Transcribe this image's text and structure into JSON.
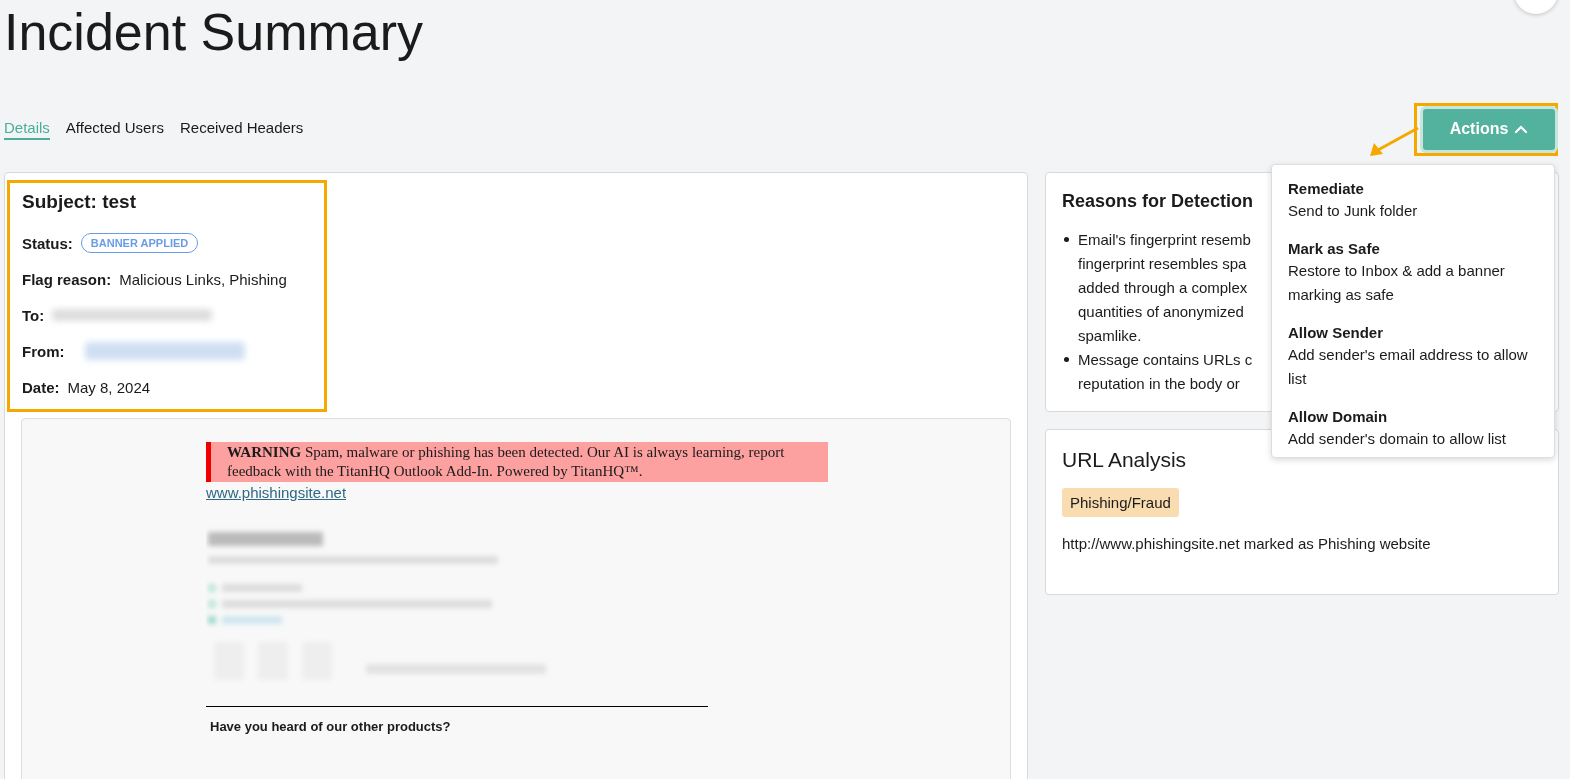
{
  "page": {
    "title": "Incident Summary"
  },
  "tabs": [
    {
      "label": "Details",
      "selected": true
    },
    {
      "label": "Affected Users",
      "selected": false
    },
    {
      "label": "Received Headers",
      "selected": false
    }
  ],
  "actions_button": {
    "label": "Actions",
    "expanded": true
  },
  "actions_menu": [
    {
      "title": "Remediate",
      "description": "Send to Junk folder"
    },
    {
      "title": "Mark as Safe",
      "description": "Restore to Inbox & add a banner marking as safe"
    },
    {
      "title": "Allow Sender",
      "description": "Add sender's email address to allow list"
    },
    {
      "title": "Allow Domain",
      "description": "Add sender's domain to allow list"
    }
  ],
  "summary": {
    "subject": "Subject: test",
    "fields": [
      {
        "label": "Status:",
        "kind": "badge",
        "value": "BANNER APPLIED"
      },
      {
        "label": "Flag reason:",
        "kind": "text",
        "value": "Malicious Links, Phishing"
      },
      {
        "label": "To:",
        "kind": "redacted"
      },
      {
        "label": "From:",
        "kind": "redacted_highlight"
      },
      {
        "label": "Date:",
        "kind": "text",
        "value": "May 8, 2024"
      }
    ]
  },
  "email_preview": {
    "warning": "**WARNING** Spam, malware or phishing has been detected. Our AI is always learning, report feedback with the TitanHQ Outlook Add-In. Powered by TitanHQ™.",
    "link": "www.phishingsite.net",
    "footer_heading": "Have you heard of our other products?"
  },
  "reasons": {
    "title": "Reasons for Detection",
    "items": [
      {
        "lines": [
          "Email's fingerprint resemb",
          "fingerprint resembles spa",
          "added through a complex",
          "quantities of anonymized",
          "spamlike."
        ]
      },
      {
        "lines": [
          "Message contains URLs c",
          "reputation in the body or"
        ]
      }
    ]
  },
  "url_analysis": {
    "title": "URL Analysis",
    "tag": "Phishing/Fraud",
    "result": "http://www.phishingsite.net marked as Phishing website"
  }
}
